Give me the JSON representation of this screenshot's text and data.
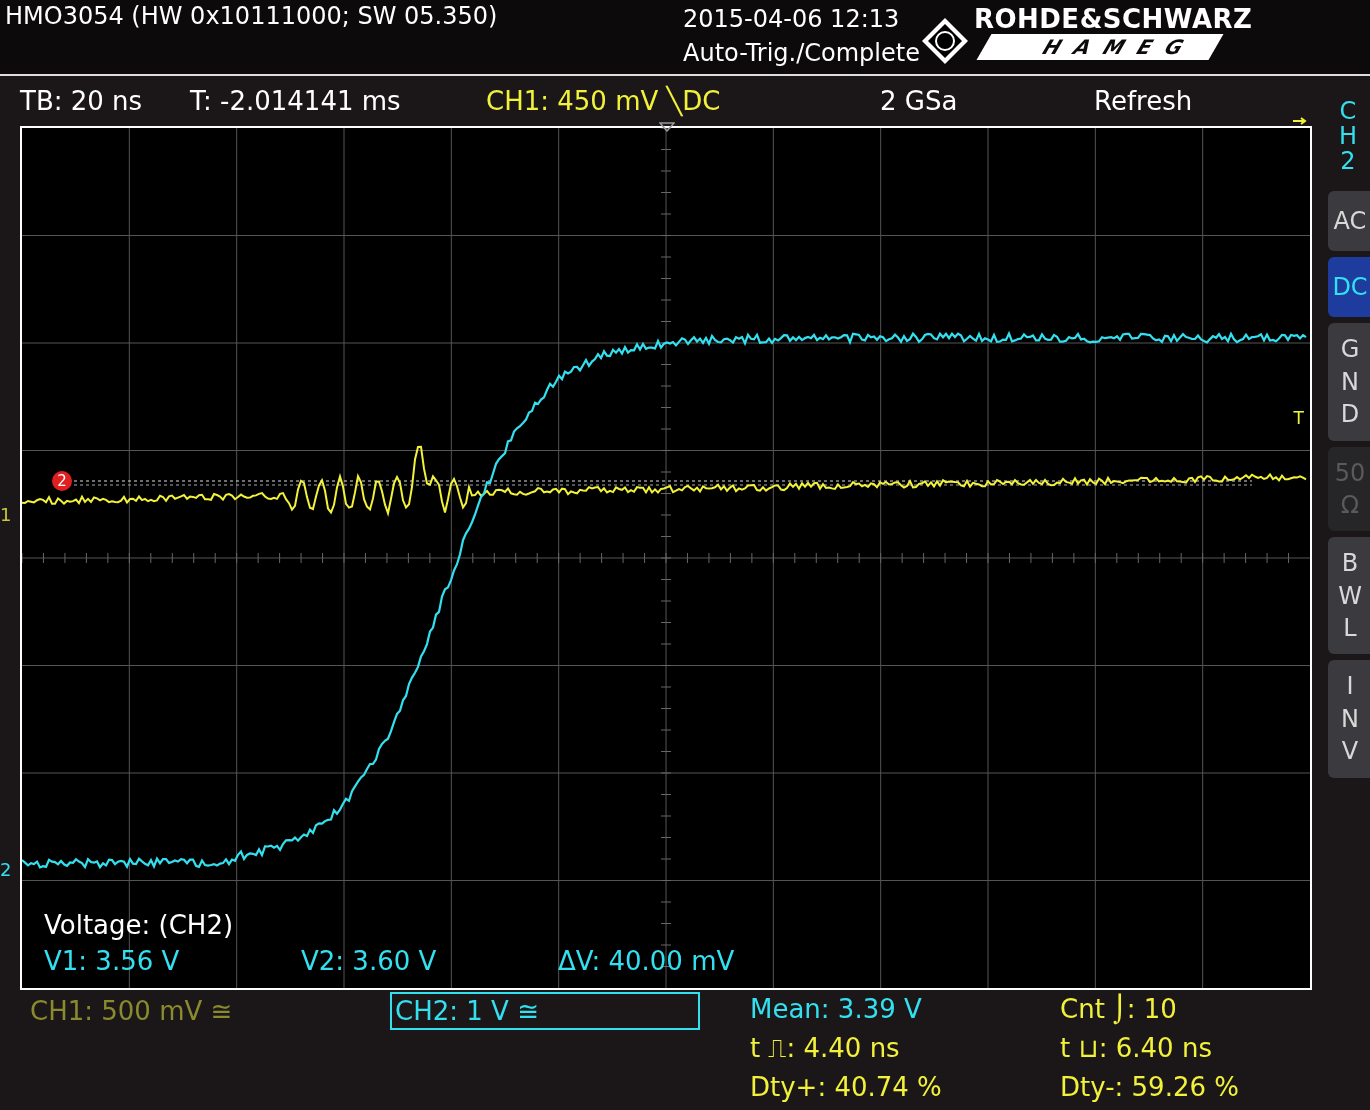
{
  "header": {
    "title": "HMO3054 (HW 0x10111000; SW 05.350)",
    "datetime": "2015-04-06 12:13",
    "status": "Auto-Trig./Complete",
    "brand_top": "ROHDE&SCHWARZ",
    "brand_bottom": "HAMEG"
  },
  "status_bar": [
    {
      "text": "TB: 20 ns",
      "color": "#ffffff"
    },
    {
      "text": "T: -2.014141 ms",
      "color": "#ffffff"
    },
    {
      "text": "CH1: 450 mV ╲DC",
      "color": "#f2f23a"
    },
    {
      "text": "2 GSa",
      "color": "#ffffff"
    },
    {
      "text": "Refresh",
      "color": "#ffffff"
    }
  ],
  "plot": {
    "channel_markers": [
      {
        "label": "1",
        "color": "#c8c83a"
      },
      {
        "label": "2",
        "color": "#33e0f0"
      }
    ],
    "reference_marker": "2",
    "trigger_marker": "T",
    "cursor_readout": {
      "title": "Voltage: (CH2)",
      "values": [
        "V1: 3.56 V",
        "V2: 3.60 V",
        "ΔV: 40.00 mV"
      ]
    }
  },
  "side_menu": {
    "title": "CH2",
    "buttons": [
      {
        "label": "AC",
        "kind": "row",
        "selected": false,
        "disabled": false
      },
      {
        "label": "DC",
        "kind": "row",
        "selected": true,
        "disabled": false
      },
      {
        "label": "GND",
        "kind": "column",
        "selected": false,
        "disabled": false
      },
      {
        "label": "50Ω",
        "kind": "wide-column",
        "selected": false,
        "disabled": true
      },
      {
        "label": "BWL",
        "kind": "column",
        "selected": false,
        "disabled": false
      },
      {
        "label": "INV",
        "kind": "column",
        "selected": false,
        "disabled": false
      }
    ]
  },
  "channels": [
    {
      "label": "CH1: 500 mV ≅",
      "color": "#8a8a2e",
      "selected": false
    },
    {
      "label": "CH2: 1 V ≅",
      "color": "#33e0f0",
      "selected": true
    }
  ],
  "measurements": [
    {
      "text": "Mean: 3.39 V",
      "color": "#33e0f0"
    },
    {
      "text": "Cnt ⌡: 10",
      "color": "#f2f23a"
    },
    {
      "text": "t ⎍: 4.40 ns",
      "color": "#f2f23a"
    },
    {
      "text": "t ⊔: 6.40 ns",
      "color": "#f2f23a"
    },
    {
      "text": "Dty+: 40.74 %",
      "color": "#f2f23a"
    },
    {
      "text": "Dty-: 59.26 %",
      "color": "#f2f23a"
    }
  ]
}
